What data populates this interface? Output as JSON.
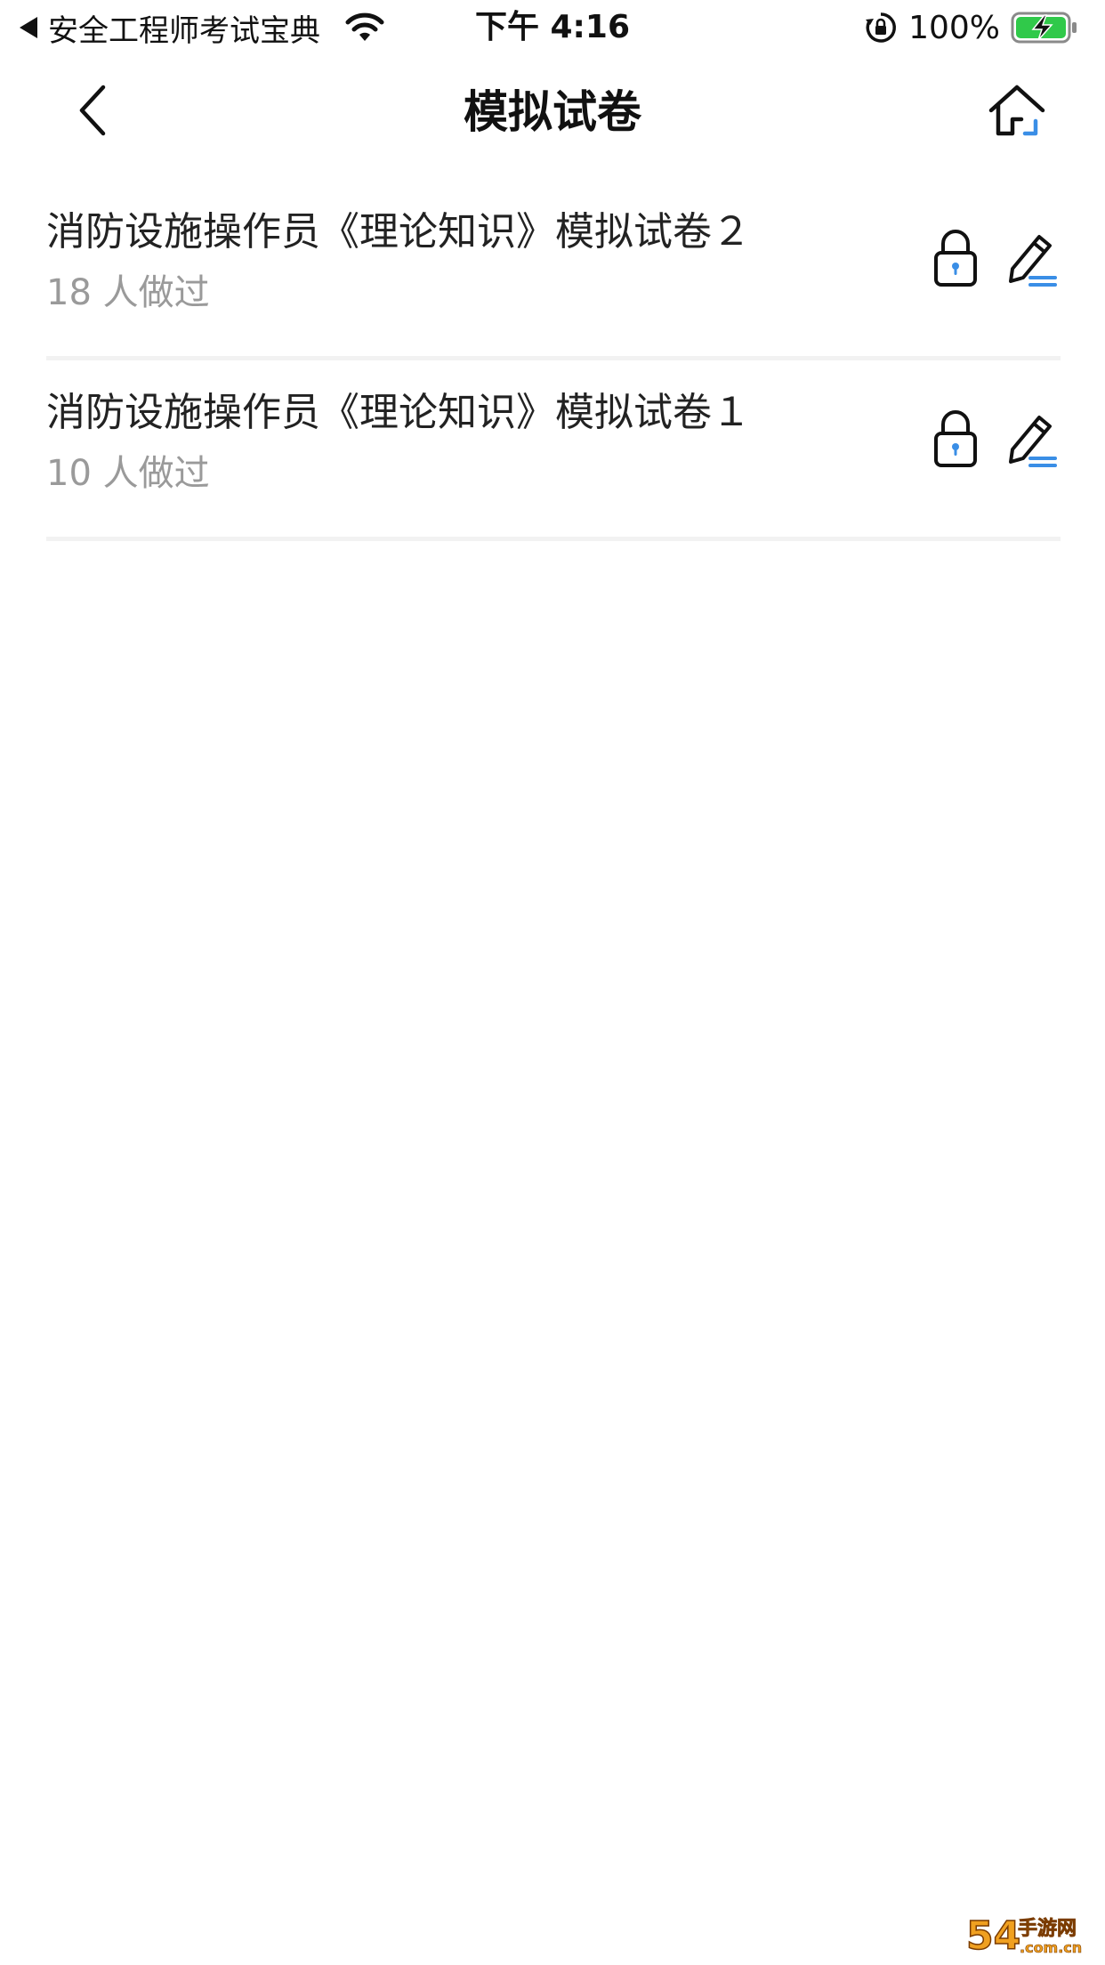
{
  "status_bar": {
    "back_app_label": "安全工程师考试宝典",
    "time": "下午 4:16",
    "battery_percent": "100%",
    "icons": [
      "back-triangle-icon",
      "wifi-icon",
      "rotation-lock-icon",
      "battery-charging-icon"
    ],
    "battery_color": "#30c94a"
  },
  "nav": {
    "title": "模拟试卷",
    "icons": [
      "chevron-left-icon",
      "home-icon"
    ],
    "accent": "#3a8ee6"
  },
  "exams": [
    {
      "title": "消防设施操作员《理论知识》模拟试卷２",
      "count": "18 人做过",
      "icons": [
        "lock-icon",
        "edit-icon"
      ]
    },
    {
      "title": "消防设施操作员《理论知识》模拟试卷１",
      "count": "10 人做过",
      "icons": [
        "lock-icon",
        "edit-icon"
      ]
    }
  ],
  "watermark": {
    "text": "54 手游网",
    "sub": ".com.cn",
    "color": "#f0a020"
  }
}
